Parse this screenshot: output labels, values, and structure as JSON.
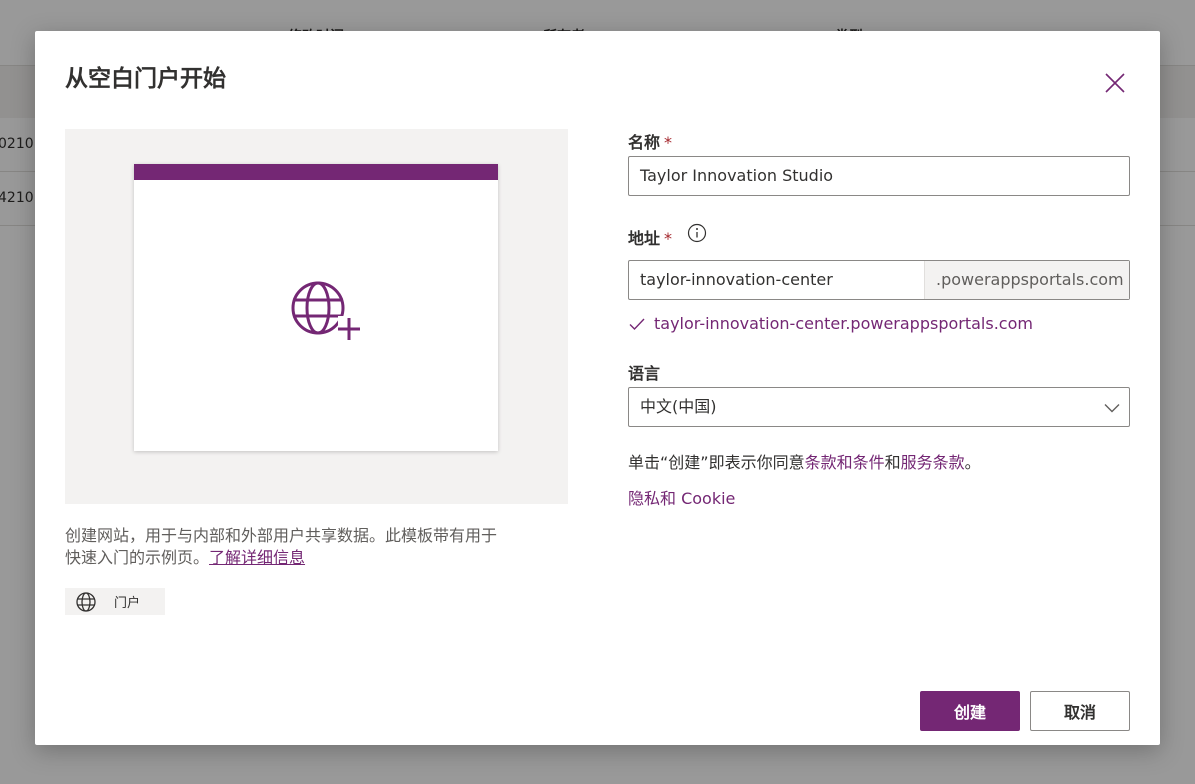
{
  "background": {
    "columns": [
      "修改时间",
      "所有者",
      "类型"
    ],
    "rows": [
      "0210",
      "4210"
    ]
  },
  "dialog": {
    "title": "从空白门户开始",
    "preview": {
      "accent_color": "#742774",
      "icon": "globe-add-icon"
    },
    "description": "创建网站，用于与内部和外部用户共享数据。此模板带有用于快速入门的示例页。",
    "learn_more_link": "了解详细信息",
    "tag": {
      "icon": "globe-icon",
      "label": "门户"
    },
    "form": {
      "name_label": "名称",
      "name_value": "Taylor Innovation Studio",
      "address_label": "地址",
      "address_value": "taylor-innovation-center",
      "address_suffix": ".powerappsportals.com",
      "address_validation": "taylor-innovation-center.powerappsportals.com",
      "language_label": "语言",
      "language_value": "中文(中国)",
      "required_mark": "*"
    },
    "terms": {
      "prefix": "单击“创建”即表示你同意",
      "link1": "条款和条件",
      "middle": "和",
      "link2": "服务条款",
      "suffix": "。"
    },
    "privacy_link": "隐私和 Cookie",
    "buttons": {
      "create": "创建",
      "cancel": "取消"
    },
    "colors": {
      "brand": "#742774",
      "required": "#a4262c"
    }
  }
}
